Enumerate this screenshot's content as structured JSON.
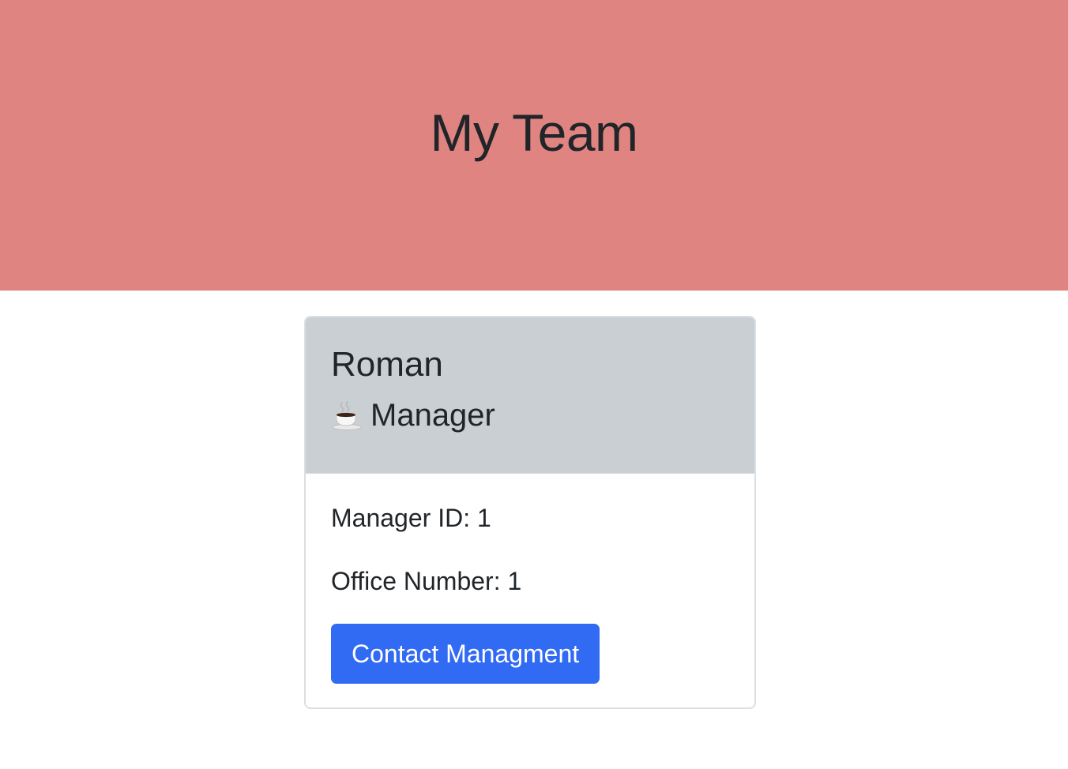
{
  "header": {
    "title": "My Team"
  },
  "card": {
    "name": "Roman",
    "role": {
      "icon": "coffee-icon",
      "label": "Manager"
    },
    "id_line": "Manager ID: 1",
    "office_line": "Office Number: 1",
    "button_label": "Contact Managment"
  },
  "colors": {
    "header_bg": "#e08481",
    "card_header_bg": "#c9cfd3",
    "button_bg": "#316af3",
    "text": "#212529"
  }
}
